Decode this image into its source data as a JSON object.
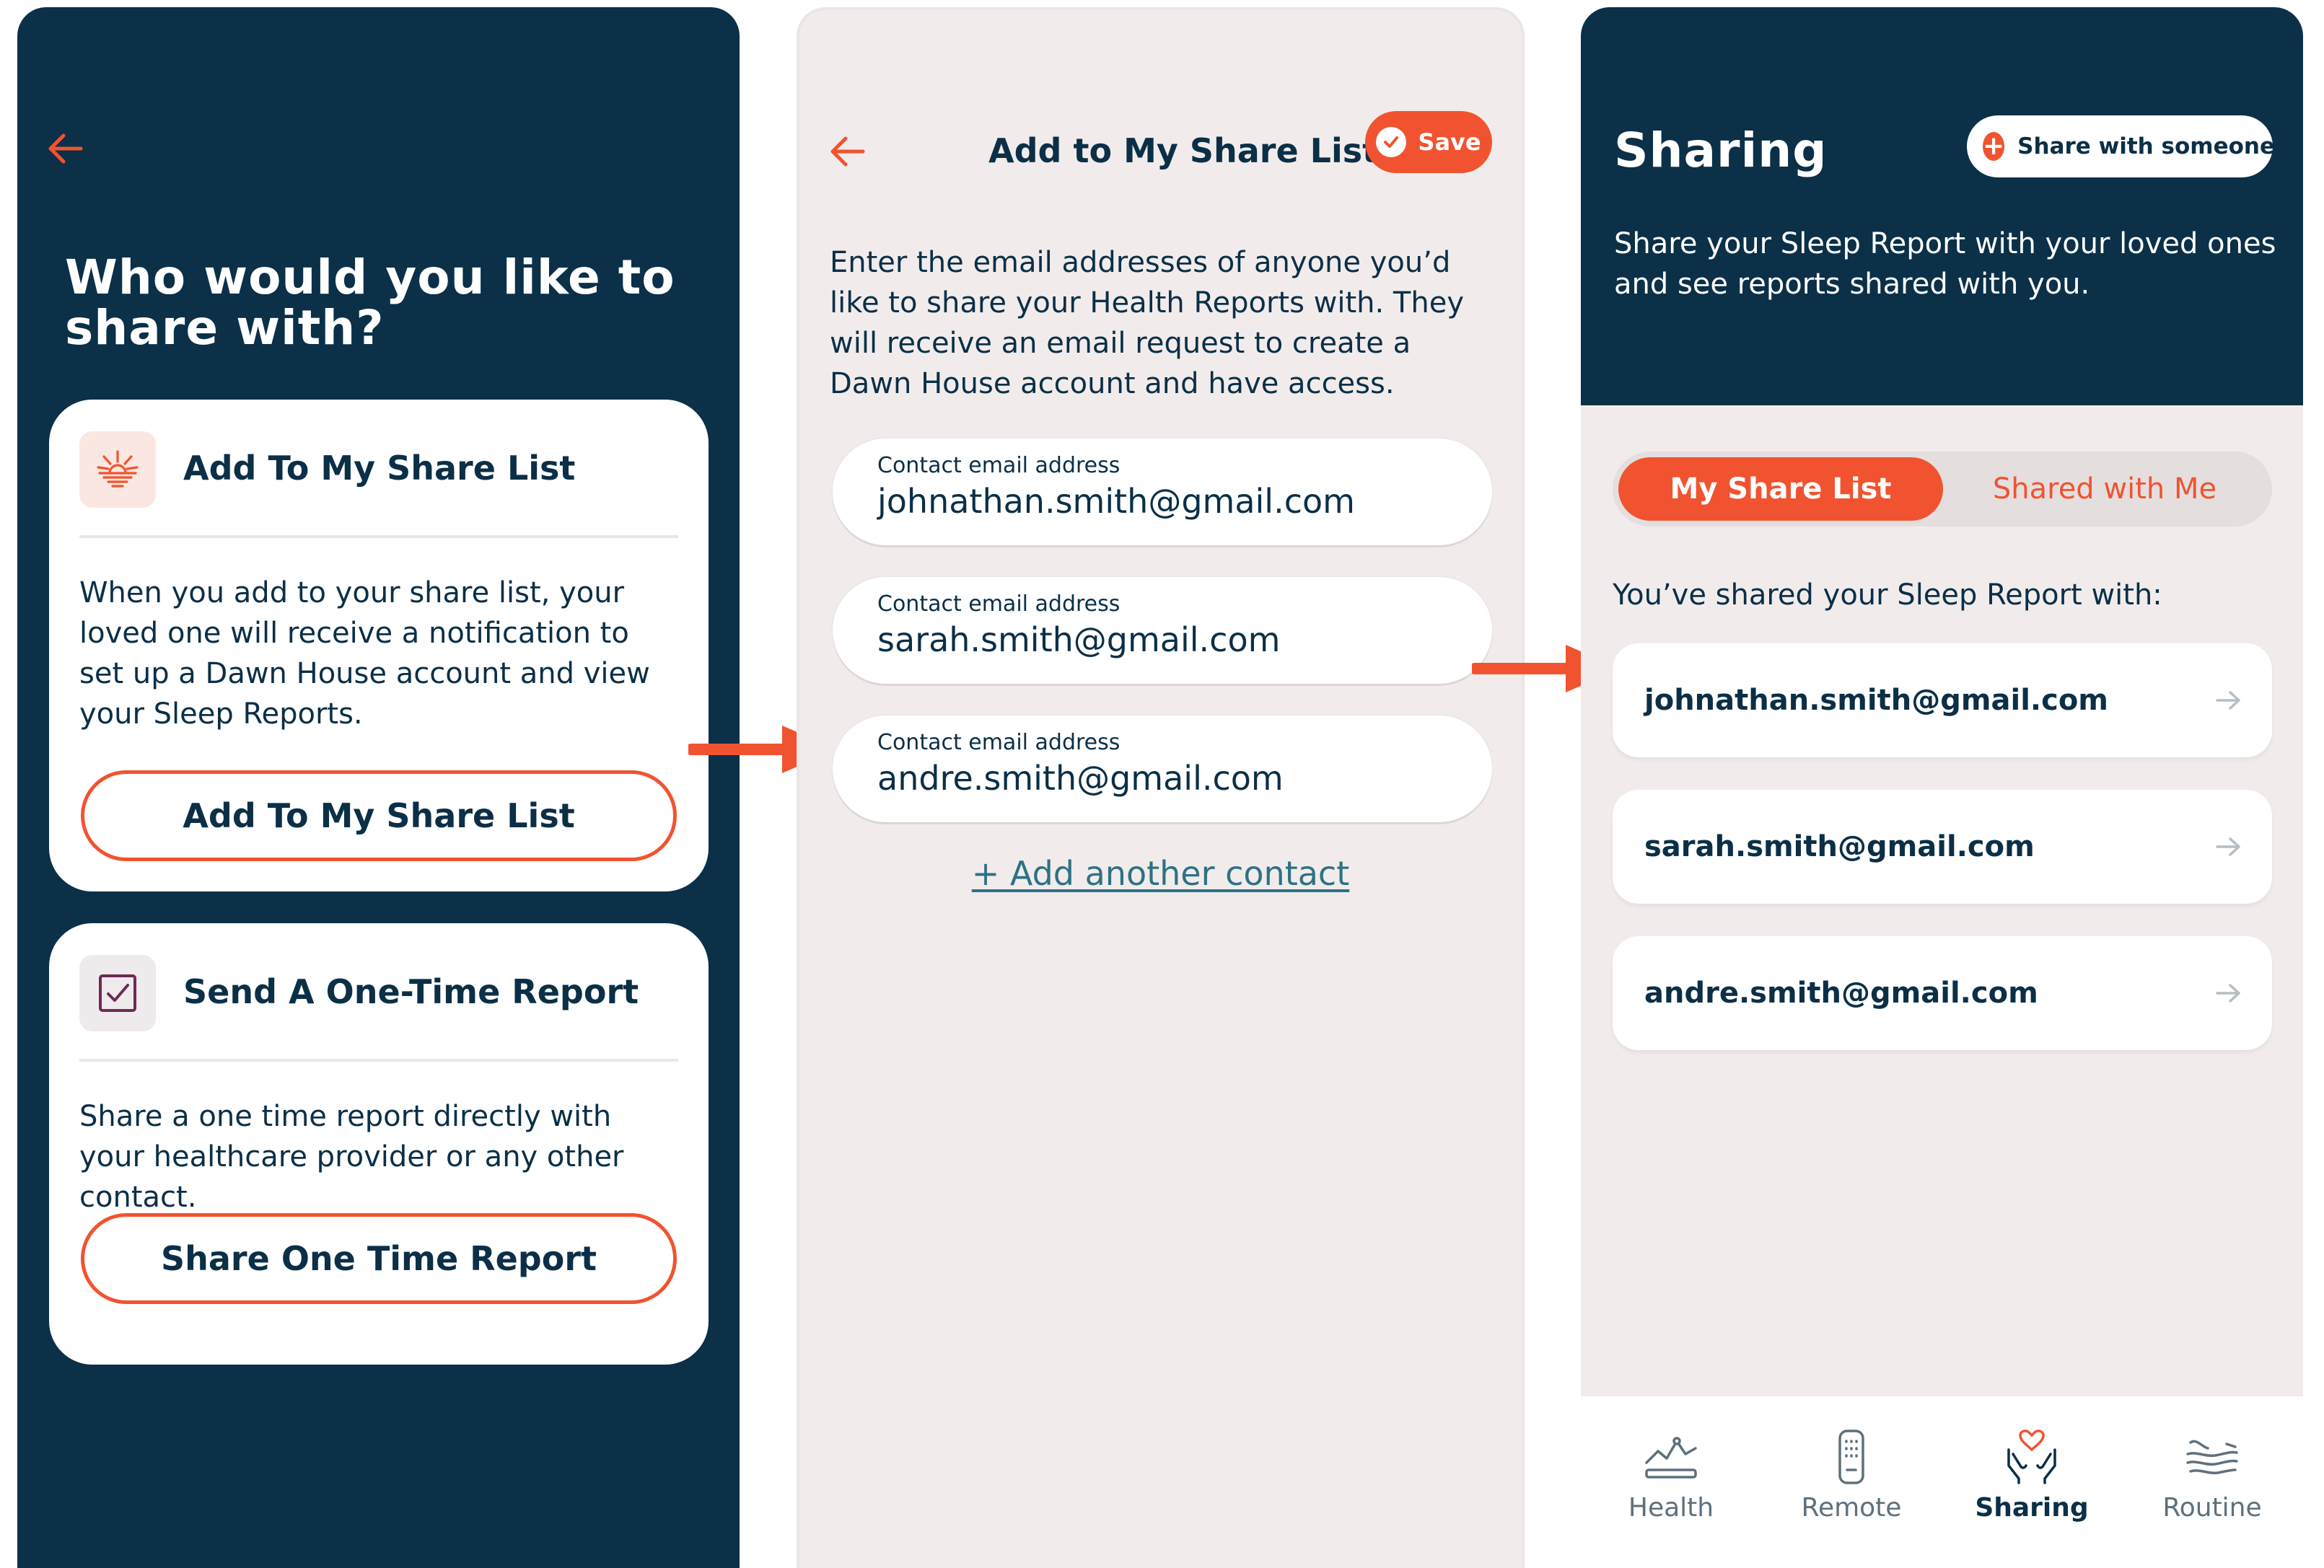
{
  "theme": {
    "navy": "#0b3048",
    "accent": "#f15330",
    "panel_bg": "#f1eceb",
    "link": "#2d7284"
  },
  "panel1": {
    "back_icon": "arrow-left-icon",
    "heading": "Who would you like to share with?",
    "card_share_list": {
      "icon": "sunrise-icon",
      "title": "Add To My Share List",
      "body": "When you add to your share list, your loved one will receive a notification to set up a Dawn House account and view your Sleep Reports.",
      "button": "Add To My Share List"
    },
    "card_one_time": {
      "icon": "checkbox-icon",
      "title": "Send A One-Time Report",
      "body": "Share a one time report directly with your healthcare provider or any other contact.",
      "button": "Share One Time Report"
    }
  },
  "panel2": {
    "back_icon": "arrow-left-icon",
    "title": "Add to My Share List",
    "save_label": "Save",
    "intro": "Enter the email addresses of anyone you’d like to share your Health Reports with. They will receive an email request to create a Dawn House account and have access.",
    "contacts": [
      {
        "label": "Contact email address",
        "value": "johnathan.smith@gmail.com"
      },
      {
        "label": "Contact email address",
        "value": "sarah.smith@gmail.com"
      },
      {
        "label": "Contact email address",
        "value": "andre.smith@gmail.com"
      }
    ],
    "add_another": "+ Add another contact"
  },
  "panel3": {
    "title": "Sharing",
    "share_button": "Share with someone",
    "subtitle": "Share your Sleep Report with your loved ones and see reports shared with you.",
    "tabs": [
      {
        "label": "My Share List",
        "selected": true
      },
      {
        "label": "Shared with Me",
        "selected": false
      }
    ],
    "shared_with_label": "You’ve shared your Sleep Report with:",
    "shared": [
      "johnathan.smith@gmail.com",
      "sarah.smith@gmail.com",
      "andre.smith@gmail.com"
    ],
    "nav": [
      {
        "label": "Health",
        "icon": "health-chart-icon",
        "active": false
      },
      {
        "label": "Remote",
        "icon": "remote-icon",
        "active": false
      },
      {
        "label": "Sharing",
        "icon": "heart-hands-icon",
        "active": true
      },
      {
        "label": "Routine",
        "icon": "routine-waves-icon",
        "active": false
      }
    ]
  }
}
